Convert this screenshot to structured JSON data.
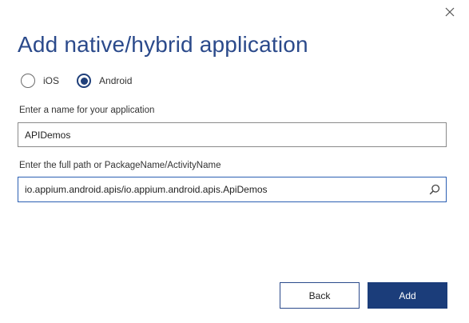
{
  "dialog": {
    "title": "Add native/hybrid application",
    "close_icon": "close-icon"
  },
  "platform": {
    "options": [
      {
        "label": "iOS",
        "selected": false
      },
      {
        "label": "Android",
        "selected": true
      }
    ]
  },
  "app_name": {
    "label": "Enter a name for your application",
    "value": "APIDemos"
  },
  "app_path": {
    "label": "Enter the full path or PackageName/ActivityName",
    "value": "io.appium.android.apis/io.appium.android.apis.ApiDemos",
    "search_icon": "search-icon"
  },
  "buttons": {
    "back_label": "Back",
    "add_label": "Add"
  },
  "colors": {
    "title": "#2b4a8b",
    "primary": "#1b3d7a",
    "focus_border": "#2b5fb3"
  }
}
